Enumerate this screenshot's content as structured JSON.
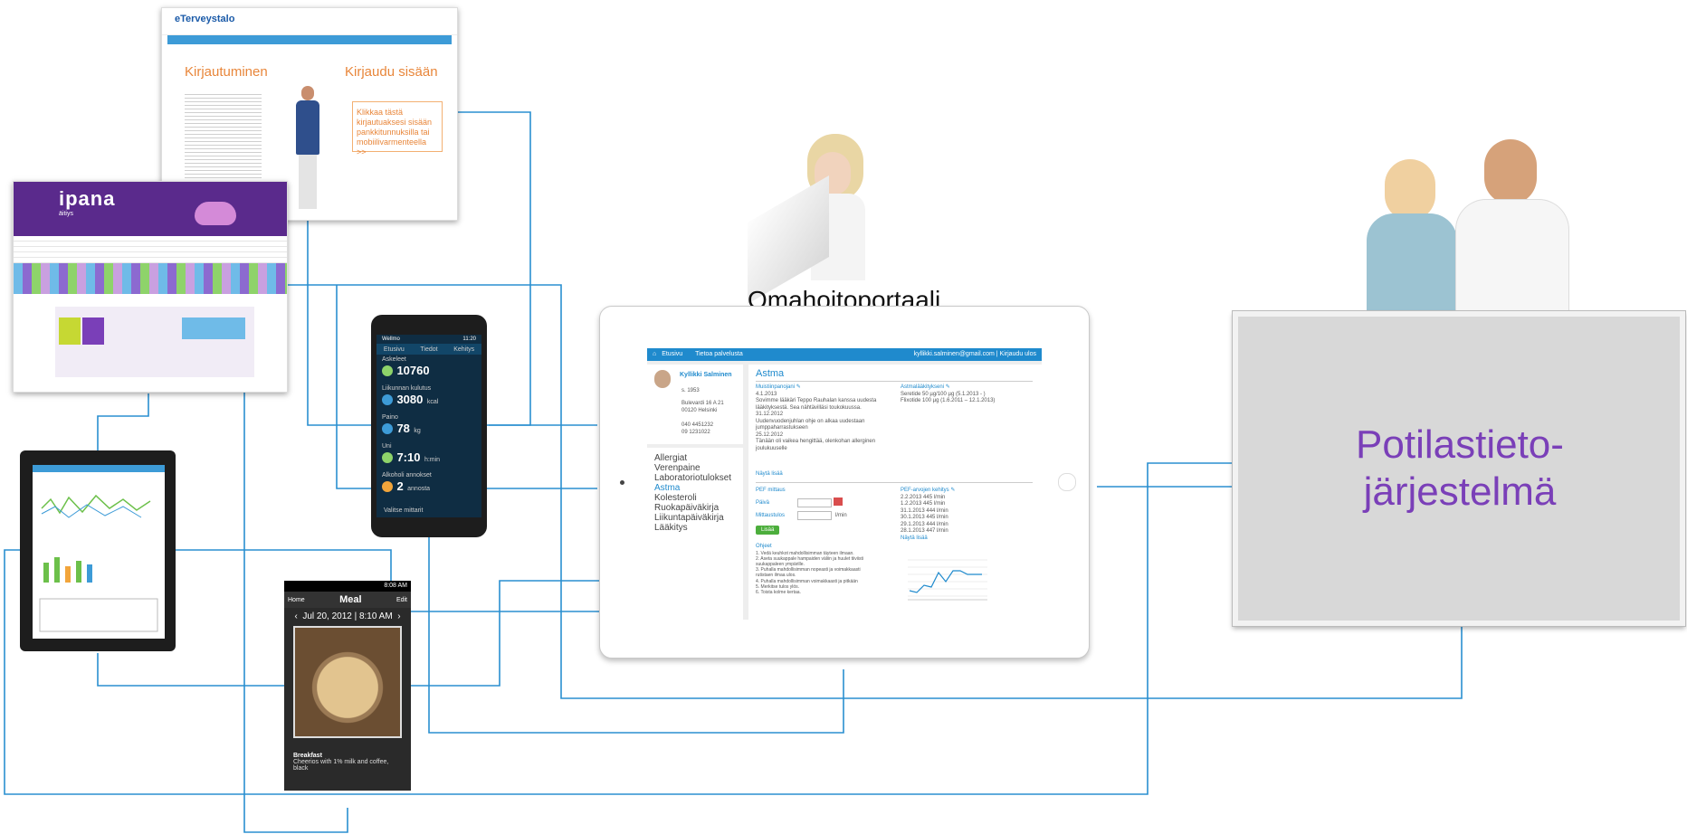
{
  "portal": {
    "caption": "Omahoitoportaali",
    "nav_home": "Etusivu",
    "nav_services": "Tietoa palvelusta",
    "account": "kyllikki.salminen@gmail.com | Kirjaudu ulos",
    "patient_name": "Kyllikki Salminen",
    "patient_born": "s. 1953",
    "patient_address": [
      "Bulevardi 16 A 21",
      "00120 Helsinki"
    ],
    "patient_phone": [
      "040 4451232",
      "09 1231022"
    ],
    "menu": [
      "Allergiat",
      "Verenpaine",
      "Laboratoriotulokset",
      "Astma",
      "Kolesteroli",
      "Ruokapäiväkirja",
      "Liikuntapäiväkirja",
      "Lääkitys"
    ],
    "menu_active": "Astma",
    "heading": "Astma",
    "notes_title": "Muistiinpanojani",
    "notes_lines": [
      "4.1.2013",
      "Sovimme lääkäri Teppo Rauhalan kanssa uudesta",
      "lääkityksestä. Sea nähtävilläsi toukokuussa.",
      "31.12.2012",
      "Uudenvuodenjuhlan ohje on alkaa uudestaan",
      "jumppaharrastukseen",
      "25.12.2012",
      "Tänään oli vaikea hengittää, olenkohan allerginen",
      "joulukuuselle"
    ],
    "notes_more": "Näytä lisää",
    "meds_title": "Astmalääkitykseni",
    "meds_lines": [
      "Seretide 50 µg/100 µg (5.1.2013 - )",
      "Flixotide 100 µg (1.6.2011 – 12.1.2013)"
    ],
    "pef_title": "PEF mittaus",
    "pef_day_label": "Päivä",
    "pef_value_label": "Mittaustulos",
    "pef_unit": "l/min",
    "pef_add": "Lisää",
    "guide_title": "Ohjeet",
    "guide_lines": [
      "1. Vedä keuhkot mahdollisimman täyteen ilmaan.",
      "2. Aseta suukappale hampaiden väliin ja huulet tiiviisti",
      "suukappaleen ympärille.",
      "3. Puhalla mahdollisimman nopeasti ja voimakkaasti",
      "rutistaen ilmaa ulos.",
      "4. Puhalla mahdollisimman voimakkaasti ja pitkään",
      "5. Merkitse tulos ylös.",
      "6. Toista kolme kertaa."
    ],
    "pef_hist_title": "PEF-arvojen kehitys",
    "pef_hist": [
      "2.2.2013   445 l/min",
      "1.2.2013   445 l/min",
      "31.1.2013  444 l/min",
      "30.1.2013  445 l/min",
      "29.1.2013  444 l/min",
      "28.1.2013  447 l/min"
    ],
    "pef_hist_more": "Näytä lisää"
  },
  "system": {
    "label": "Potilastieto-järjestelmä"
  },
  "login_page": {
    "brand": "eTerveystalo",
    "left_title": "Kirjautuminen",
    "right_title": "Kirjaudu sisään",
    "login_box": "Klikkaa tästä kirjautuaksesi sisään pankkitunnuksilla tai mobiilivarmenteella >>"
  },
  "ipana_page": {
    "brand": "ipana",
    "sub": "äitiys"
  },
  "wellmo_phone": {
    "app": "Wellmo",
    "time": "11:20",
    "tabs": [
      "Etusivu",
      "Tiedot",
      "Kehitys"
    ],
    "metrics": [
      {
        "label": "Askeleet",
        "value": "10760",
        "unit": ""
      },
      {
        "label": "Liikunnan kulutus",
        "value": "3080",
        "unit": "kcal"
      },
      {
        "label": "Paino",
        "value": "78",
        "unit": "kg"
      },
      {
        "label": "Uni",
        "value": "7:10",
        "unit": "h:min"
      },
      {
        "label": "Alkoholi annokset",
        "value": "2",
        "unit": "annosta"
      }
    ],
    "footer": "Valitse mittarit"
  },
  "meal_phone": {
    "status_time": "8:08 AM",
    "back": "Home",
    "title": "Meal",
    "edit": "Edit",
    "date": "Jul 20, 2012 | 8:10 AM",
    "meal_name": "Breakfast",
    "meal_desc": "Cheerios with 1% milk and coffee, black"
  },
  "colors": {
    "line": "#1f8acd",
    "purple": "#7a3fb8",
    "orange": "#e8863a"
  }
}
